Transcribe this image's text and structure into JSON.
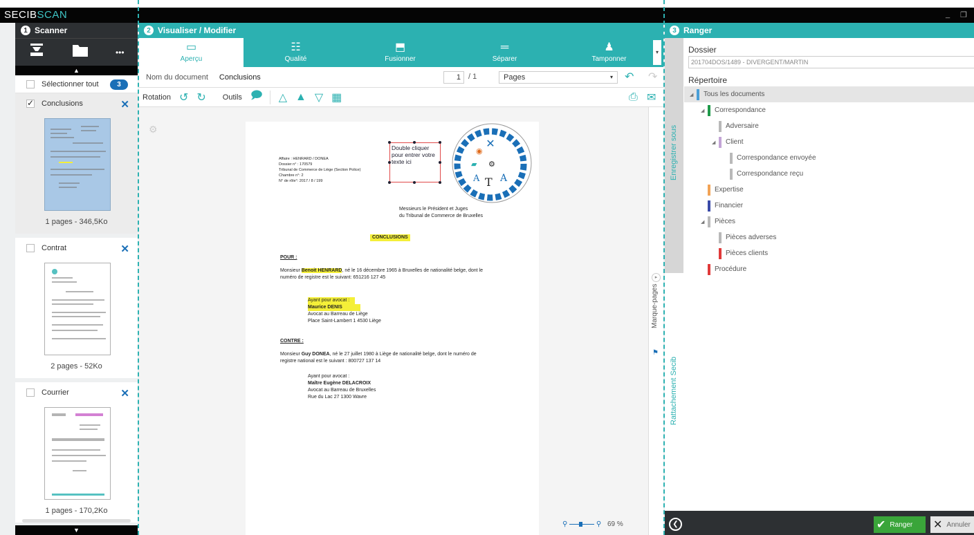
{
  "app": {
    "logo_a": "SECIB",
    "logo_b": "SCAN",
    "win_min": "_",
    "win_max": "❐"
  },
  "col1": {
    "num": "1",
    "title": "Scanner",
    "more": "•••",
    "up": "▲",
    "down": "▼",
    "select_all": "Sélectionner tout",
    "count": "3",
    "cards": [
      {
        "name": "Conclusions",
        "pages": "1 pages - 346,5Ko",
        "close": "✕"
      },
      {
        "name": "Contrat",
        "pages": "2 pages - 52Ko",
        "close": "✕"
      },
      {
        "name": "Courrier",
        "pages": "1 pages - 170,2Ko",
        "close": "✕"
      }
    ]
  },
  "col2": {
    "num": "2",
    "title": "Visualiser / Modifier",
    "tabs": [
      {
        "label": "Aperçu",
        "icon": "▭"
      },
      {
        "label": "Qualité",
        "icon": "☷"
      },
      {
        "label": "Fusionner",
        "icon": "⬒"
      },
      {
        "label": "Séparer",
        "icon": "═"
      },
      {
        "label": "Tamponner",
        "icon": "♟"
      }
    ],
    "tab_menu": "▾",
    "doc_label": "Nom du document",
    "doc_value": "Conclusions",
    "page_current": "1",
    "page_total": "/ 1",
    "page_select": "Pages",
    "caret": "▾",
    "undo": "↶",
    "redo": "↷",
    "rotation": "Rotation",
    "tools": "Outils",
    "zoom": "69 %",
    "bookmarks": "Marque-pages",
    "bm_circle": "▸",
    "doc": {
      "header": "Affaire : HENRARD / DONEA\nDossier n° : 170579\nTribunal de Commerce de Liège (Section Police)\nChambre n°: 2\nN° de rôle°: 2017 / 8 / 199",
      "addressee": "Messieurs le Président et Juges\ndu Tribunal de Commerce de Bruxelles",
      "title": "CONCLUSIONS",
      "pour": "POUR :",
      "p1_a": "Monsieur ",
      "p1_name": "Benoit HENRARD",
      "p1_b": ", né le 16 décembre 1965 à Bruxelles de nationalité belge, dont le",
      "p1_c": "numéro de registre est le suivant: 651216 127 45",
      "av1_label": "Ayant pour avocat :",
      "av1_name": "Maurice DENIS",
      "av1_rest": "Avocat au Barreau de Liège\nPlace Saint-Lambert 1 4530 Liège",
      "contre": "CONTRE :",
      "p2_a": "Monsieur ",
      "p2_name": "Guy DONEA",
      "p2_b": ", né le 27 juillet 1980 à Liège de nationalité belge, dont le numéro de",
      "p2_c": "registre national est le suivant : 800727 137 14",
      "av2_label": "Ayant pour avocat :",
      "av2_name": "Maître Eugène DELACROIX",
      "av2_rest": "Avocat au Barreau de Bruxelles\nRue du Lac 27 1300 Wavre",
      "textbox": "Double cliquer\npour entrer votre\ntexte ici"
    }
  },
  "col3": {
    "num": "3",
    "title": "Ranger",
    "dossier_label": "Dossier",
    "dossier_value": "201704DOS/1489 - DIVERGENT/MARTIN",
    "repertoire": "Répertoire",
    "save_under": "Enregistrer sous",
    "attach": "Rattachement Secib",
    "tree": [
      {
        "label": "Tous les documents",
        "level": 0,
        "color": "#4a9fd8",
        "twisty": "◢",
        "sel": true
      },
      {
        "label": "Correspondance",
        "level": 1,
        "color": "#1f9a4a",
        "twisty": "◢"
      },
      {
        "label": "Adversaire",
        "level": 2,
        "color": "#b9b9b9",
        "twisty": ""
      },
      {
        "label": "Client",
        "level": 2,
        "color": "#c3a5d6",
        "twisty": "◢"
      },
      {
        "label": "Correspondance envoyée",
        "level": 3,
        "color": "#b9b9b9",
        "twisty": ""
      },
      {
        "label": "Correspondance reçu",
        "level": 3,
        "color": "#b9b9b9",
        "twisty": ""
      },
      {
        "label": "Expertise",
        "level": 1,
        "color": "#f2a356",
        "twisty": ""
      },
      {
        "label": "Financier",
        "level": 1,
        "color": "#3a4aa8",
        "twisty": ""
      },
      {
        "label": "Pièces",
        "level": 1,
        "color": "#b9b9b9",
        "twisty": "◢"
      },
      {
        "label": "Pièces adverses",
        "level": 2,
        "color": "#b9b9b9",
        "twisty": ""
      },
      {
        "label": "Pièces clients",
        "level": 2,
        "color": "#e03a3a",
        "twisty": ""
      },
      {
        "label": "Procédure",
        "level": 1,
        "color": "#e03a3a",
        "twisty": ""
      }
    ],
    "back": "❮",
    "ranger": "Ranger",
    "ranger_icon": "✔",
    "annuler": "Annuler",
    "annuler_icon": "✕"
  }
}
